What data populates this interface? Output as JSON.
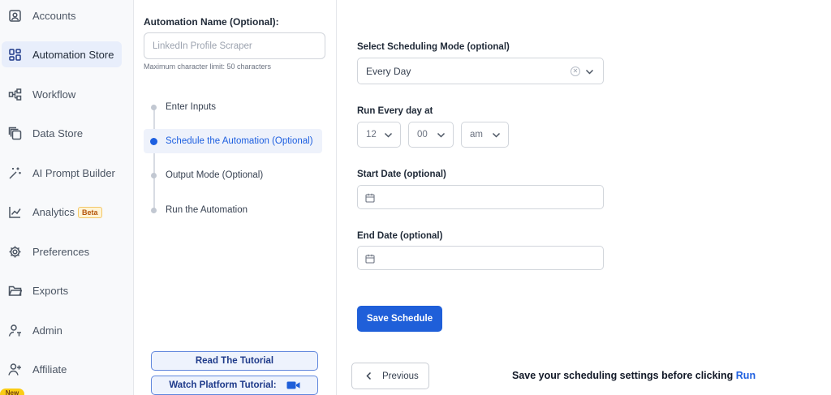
{
  "sidebar": {
    "items": [
      {
        "label": "Accounts",
        "icon": "user-square-icon"
      },
      {
        "label": "Automation Store",
        "icon": "grid-icon",
        "active": true
      },
      {
        "label": "Workflow",
        "icon": "workflow-icon"
      },
      {
        "label": "Data Store",
        "icon": "stacked-pages-icon"
      },
      {
        "label": "AI Prompt Builder",
        "icon": "magic-wand-icon"
      },
      {
        "label": "Analytics",
        "icon": "line-chart-icon",
        "badge": "Beta"
      },
      {
        "label": "Preferences",
        "icon": "gear-icon"
      },
      {
        "label": "Exports",
        "icon": "folder-icon"
      },
      {
        "label": "Admin",
        "icon": "admin-user-icon"
      },
      {
        "label": "Affiliate",
        "icon": "add-user-icon"
      }
    ],
    "new_badge": "New"
  },
  "middle": {
    "automation_name_label": "Automation Name (Optional):",
    "automation_name_placeholder": "LinkedIn Profile Scraper",
    "char_limit_note": "Maximum character limit: 50 characters",
    "steps": [
      {
        "label": "Enter Inputs"
      },
      {
        "label": "Schedule the Automation (Optional)",
        "active": true
      },
      {
        "label": "Output Mode (Optional)"
      },
      {
        "label": "Run the Automation"
      }
    ],
    "read_tutorial": "Read The Tutorial",
    "watch_tutorial": "Watch Platform Tutorial:"
  },
  "form": {
    "mode_label": "Select Scheduling Mode (optional)",
    "mode_value": "Every Day",
    "run_every_label": "Run Every day at",
    "hour": "12",
    "minute": "00",
    "ampm": "am",
    "start_date_label": "Start Date (optional)",
    "end_date_label": "End Date (optional)",
    "save_button": "Save Schedule",
    "previous_button": "Previous",
    "footer_note": "Save your scheduling settings before clicking ",
    "footer_run": "Run"
  },
  "colors": {
    "accent": "#1f5fd9",
    "active_nav_bg": "#e8eefb",
    "beta_bg": "#fff4d6"
  }
}
